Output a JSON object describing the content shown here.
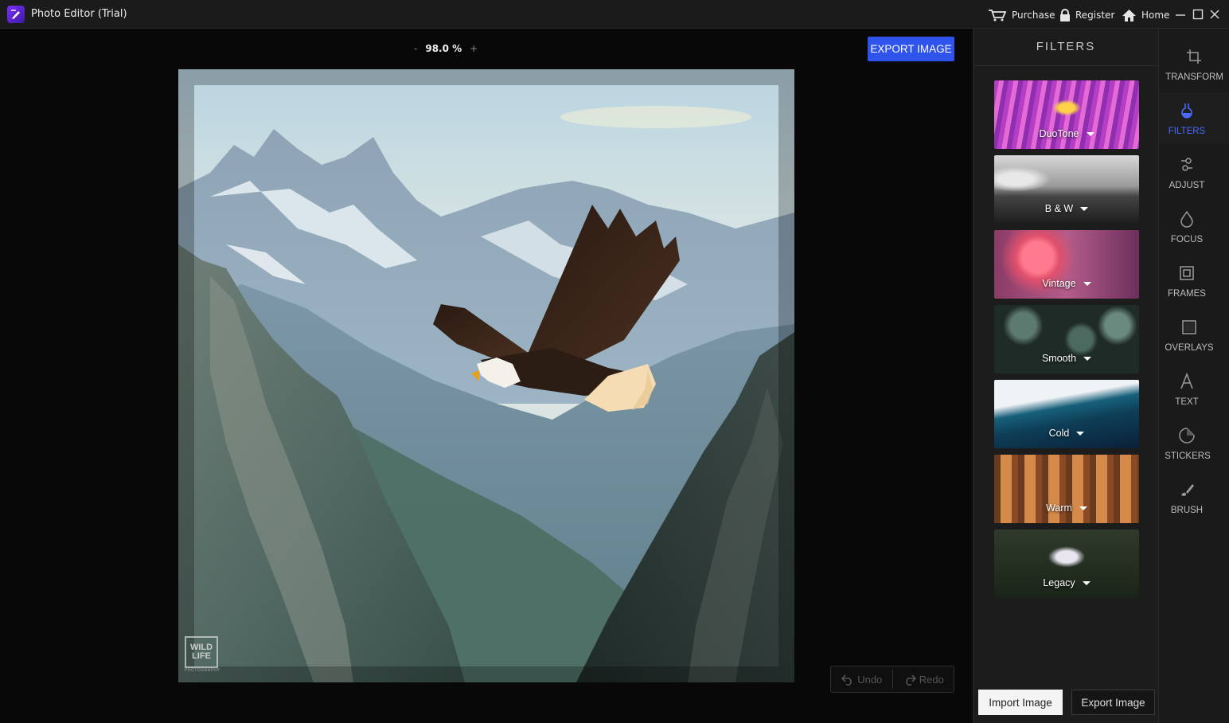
{
  "window": {
    "title": "Photo Editor (Trial)",
    "links": {
      "purchase": "Purchase",
      "register": "Register",
      "home": "Home"
    }
  },
  "canvas": {
    "zoom_minus": "-",
    "zoom_value": "98.0 %",
    "zoom_plus": "+",
    "export_label": "EXPORT IMAGE",
    "watermark_line1": "WILD",
    "watermark_line2": "LIFE",
    "watermark_sub": "PHOTOGRAPHY",
    "undo_label": "Undo",
    "redo_label": "Redo"
  },
  "filters": {
    "header": "FILTERS",
    "items": [
      {
        "label": "DuoTone"
      },
      {
        "label": "B & W"
      },
      {
        "label": "Vintage"
      },
      {
        "label": "Smooth"
      },
      {
        "label": "Cold"
      },
      {
        "label": "Warm"
      },
      {
        "label": "Legacy"
      }
    ],
    "import_label": "Import Image",
    "export_label": "Export Image"
  },
  "tools": {
    "active": "FILTERS",
    "accent_color": "#4b6bff",
    "items": [
      {
        "label": "TRANSFORM",
        "icon": "crop-icon"
      },
      {
        "label": "FILTERS",
        "icon": "flask-icon"
      },
      {
        "label": "ADJUST",
        "icon": "sliders-icon"
      },
      {
        "label": "FOCUS",
        "icon": "drop-icon"
      },
      {
        "label": "FRAMES",
        "icon": "frame-icon"
      },
      {
        "label": "OVERLAYS",
        "icon": "square-icon"
      },
      {
        "label": "TEXT",
        "icon": "text-icon"
      },
      {
        "label": "STICKERS",
        "icon": "sticker-icon"
      },
      {
        "label": "BRUSH",
        "icon": "brush-icon"
      }
    ]
  }
}
